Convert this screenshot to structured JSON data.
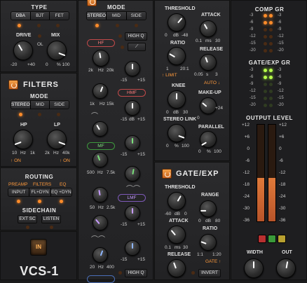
{
  "left": {
    "type_title": "TYPE",
    "type_opts": [
      "DBA",
      "BJT",
      "FET"
    ],
    "drive_label": "DRIVE",
    "mix_label": "MIX",
    "ol_label": "OL",
    "drive_scale": [
      "-20",
      "+40"
    ],
    "mix_scale": [
      "0",
      "% 100"
    ],
    "filters_title": "FILTERS",
    "mode_title": "MODE",
    "mode_opts": [
      "STEREO",
      "MID",
      "SIDE"
    ],
    "hp_label": "HP",
    "lp_label": "LP",
    "hp_scale": [
      "10",
      "Hz",
      "1k"
    ],
    "lp_scale": [
      "2k",
      "Hz",
      "40k"
    ],
    "on_label": "ON",
    "routing_title": "ROUTING",
    "routing_cols": [
      "PREAMP",
      "FILTERS",
      "EQ"
    ],
    "routing_opts": [
      "INPUT",
      "FL+DYN",
      "EQ +DYN"
    ],
    "sidechain_title": "SIDECHAIN",
    "sidechain_opts": [
      "EXT SC",
      "LISTEN"
    ],
    "in_label": "IN",
    "product": "VCS-1"
  },
  "eq": {
    "mode_title": "MODE",
    "mode_opts": [
      "STEREO",
      "MID",
      "SIDE"
    ],
    "high_q": "HIGH Q",
    "hf": "HF",
    "hf_scale": [
      "2k",
      "Hz",
      "20k"
    ],
    "gain_scale": [
      "-15",
      "dB",
      "+15"
    ],
    "hmf": "HMF",
    "hmf_scale": [
      "1k",
      "Hz",
      "15k"
    ],
    "mf": "MF",
    "mf_scale": [
      "500",
      "Hz",
      "7.5k"
    ],
    "lmf": "LMF",
    "lmf_scale": [
      "50",
      "Hz",
      "2.5k"
    ],
    "lf_scale": [
      "20",
      "Hz",
      "400"
    ],
    "high_q_bottom": "HIGH Q"
  },
  "comp": {
    "threshold": "THRESHOLD",
    "attack": "ATTACK",
    "thr_scale": [
      "0",
      "dB",
      "-48"
    ],
    "atk_scale": [
      "0.1",
      "ms",
      "30"
    ],
    "ratio": "RATIO",
    "release": "RELEASE",
    "ratio_scale": [
      "1",
      "20:1"
    ],
    "rel_scale": [
      "0.05",
      "s",
      "3"
    ],
    "limit": "LIMIT",
    "auto": "AUTO",
    "knee": "KNEE",
    "makeup": "MAKE-UP",
    "knee_scale": [
      "0",
      "dB",
      "30"
    ],
    "makeup_scale": [
      "0",
      "dB",
      "+24"
    ],
    "stereo_link": "STEREO LINK",
    "parallel": "PARALLEL",
    "link_scale": [
      "0",
      "%",
      "100"
    ],
    "par_scale": [
      "0",
      "%",
      "100"
    ]
  },
  "gate": {
    "title": "GATE/EXP",
    "threshold": "THRESHOLD",
    "range": "RANGE",
    "thr_scale": [
      "-60",
      "dB",
      "0"
    ],
    "range_scale": [
      "0",
      "dB",
      "80"
    ],
    "attack": "ATTACK",
    "ratio": "RATIO",
    "atk_scale": [
      "0.1",
      "ms",
      "30"
    ],
    "ratio_scale": [
      "1:1",
      "1:20"
    ],
    "gate": "GATE",
    "release": "RELEASE",
    "invert": "INVERT"
  },
  "meters": {
    "comp_gr": "COMP GR",
    "comp_gr_scale": [
      "-3",
      "-6",
      "-9",
      "-12",
      "-15",
      "-20"
    ],
    "gate_gr": "GATE/EXP GR",
    "gate_gr_scale": [
      "-3",
      "-6",
      "-9",
      "-12",
      "-15",
      "-20"
    ],
    "output_level": "OUTPUT LEVEL",
    "output_scale": [
      "+12",
      "+6",
      "0",
      "-6",
      "-12",
      "-18",
      "-24",
      "-30",
      "-36"
    ],
    "width": "WIDTH",
    "out": "OUT"
  }
}
